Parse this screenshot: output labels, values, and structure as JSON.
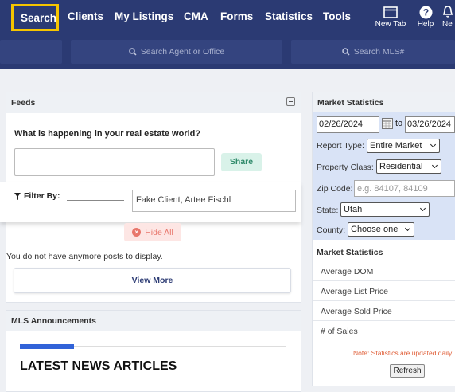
{
  "nav": {
    "items": [
      "Search",
      "Clients",
      "My Listings",
      "CMA",
      "Forms",
      "Statistics",
      "Tools"
    ],
    "right": [
      "New Tab",
      "Help",
      "Ne"
    ]
  },
  "search": {
    "agent_placeholder": "Search Agent or Office",
    "mls_placeholder": "Search MLS#"
  },
  "feeds": {
    "title": "Feeds",
    "question": "What is happening in your real estate world?",
    "share_label": "Share",
    "filter_label": "Filter By:",
    "filter_value": "Fake Client, Artee Fischl",
    "hide_all_label": "Hide All",
    "no_posts": "You do not have anymore posts to display.",
    "view_more_label": "View More"
  },
  "announcements": {
    "title": "MLS Announcements",
    "news_title": "LATEST NEWS ARTICLES"
  },
  "market": {
    "title": "Market Statistics",
    "date_from": "02/26/2024",
    "to_label": "to",
    "date_to": "03/26/2024",
    "report_type_label": "Report Type:",
    "report_type_value": "Entire Market",
    "property_class_label": "Property Class:",
    "property_class_value": "Residential",
    "zip_label": "Zip Code:",
    "zip_placeholder": "e.g. 84107, 84109",
    "state_label": "State:",
    "state_value": "Utah",
    "county_label": "County:",
    "county_value": "Choose one",
    "stats_title": "Market Statistics",
    "stats": [
      "Average DOM",
      "Average List Price",
      "Average Sold Price",
      "# of Sales"
    ],
    "note": "Note: Statistics are updated daily",
    "refresh_label": "Refresh"
  }
}
